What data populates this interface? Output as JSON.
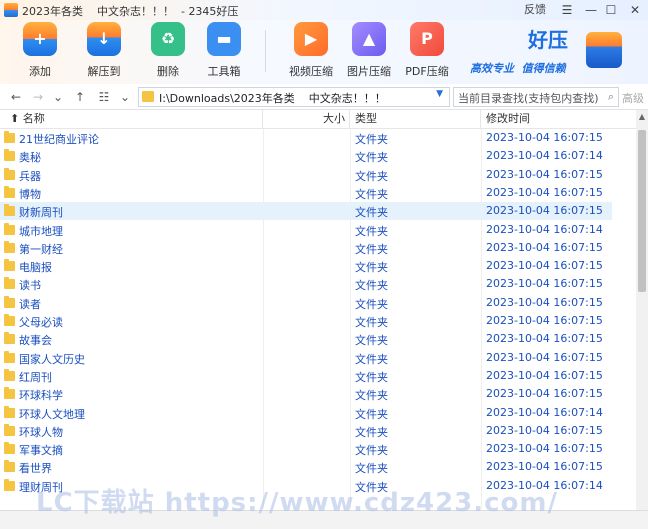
{
  "titlebar": {
    "title": "2023年各类    中文杂志！！！  - 2345好压",
    "feedback": "反馈",
    "menu_icon": "hamburger-icon",
    "minimize_icon": "minimize-icon",
    "maximize_icon": "maximize-icon",
    "close_icon": "close-icon"
  },
  "toolbar": {
    "add": "添加",
    "extract": "解压到",
    "delete": "删除",
    "toolbox": "工具箱",
    "video": "视频压缩",
    "image": "图片压缩",
    "pdf": "PDF压缩"
  },
  "brand": {
    "name": "好压",
    "slogan": "高效专业  值得信赖"
  },
  "address": {
    "path": "I:\\Downloads\\2023年各类    中文杂志！！！",
    "search_placeholder": "当前目录查找(支持包内查找)",
    "advanced": "高级"
  },
  "columns": {
    "name": "名称",
    "size": "大小",
    "type": "类型",
    "modified": "修改时间"
  },
  "rows": [
    {
      "name": "21世纪商业评论",
      "type": "文件夹",
      "modified": "2023-10-04 16:07:15"
    },
    {
      "name": "奥秘",
      "type": "文件夹",
      "modified": "2023-10-04 16:07:14"
    },
    {
      "name": "兵器",
      "type": "文件夹",
      "modified": "2023-10-04 16:07:15"
    },
    {
      "name": "博物",
      "type": "文件夹",
      "modified": "2023-10-04 16:07:15"
    },
    {
      "name": "财新周刊",
      "type": "文件夹",
      "modified": "2023-10-04 16:07:15"
    },
    {
      "name": "城市地理",
      "type": "文件夹",
      "modified": "2023-10-04 16:07:14"
    },
    {
      "name": "第一财经",
      "type": "文件夹",
      "modified": "2023-10-04 16:07:15"
    },
    {
      "name": "电脑报",
      "type": "文件夹",
      "modified": "2023-10-04 16:07:15"
    },
    {
      "name": "读书",
      "type": "文件夹",
      "modified": "2023-10-04 16:07:15"
    },
    {
      "name": "读者",
      "type": "文件夹",
      "modified": "2023-10-04 16:07:15"
    },
    {
      "name": "父母必读",
      "type": "文件夹",
      "modified": "2023-10-04 16:07:15"
    },
    {
      "name": "故事会",
      "type": "文件夹",
      "modified": "2023-10-04 16:07:15"
    },
    {
      "name": "国家人文历史",
      "type": "文件夹",
      "modified": "2023-10-04 16:07:15"
    },
    {
      "name": "红周刊",
      "type": "文件夹",
      "modified": "2023-10-04 16:07:15"
    },
    {
      "name": "环球科学",
      "type": "文件夹",
      "modified": "2023-10-04 16:07:15"
    },
    {
      "name": "环球人文地理",
      "type": "文件夹",
      "modified": "2023-10-04 16:07:14"
    },
    {
      "name": "环球人物",
      "type": "文件夹",
      "modified": "2023-10-04 16:07:15"
    },
    {
      "name": "军事文摘",
      "type": "文件夹",
      "modified": "2023-10-04 16:07:15"
    },
    {
      "name": "看世界",
      "type": "文件夹",
      "modified": "2023-10-04 16:07:15"
    },
    {
      "name": "理财周刊",
      "type": "文件夹",
      "modified": "2023-10-04 16:07:14"
    }
  ],
  "selected_row": 4,
  "watermark": "LC下载站 https://www.cdz423.com/"
}
